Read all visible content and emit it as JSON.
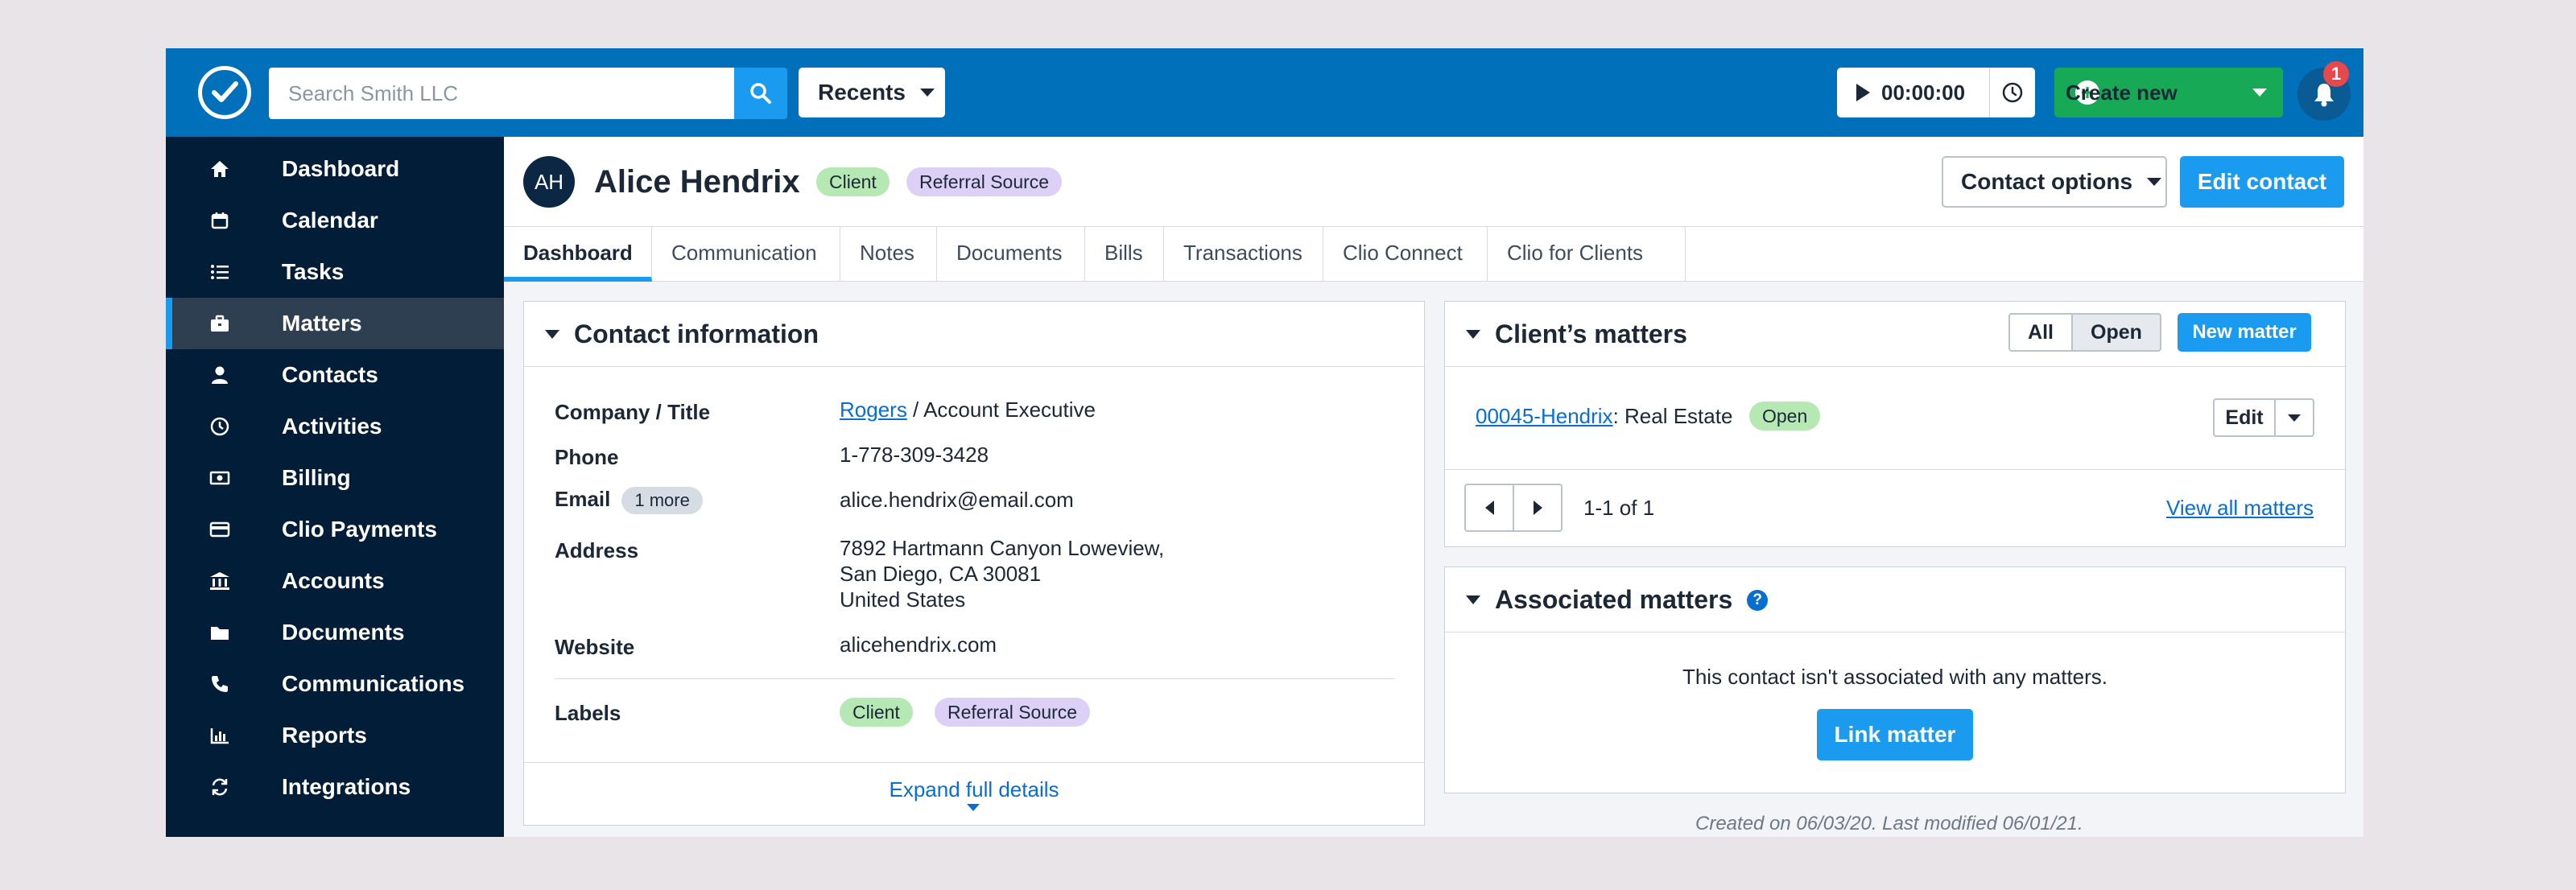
{
  "topbar": {
    "search_placeholder": "Search Smith LLC",
    "recents_label": "Recents",
    "timer": "00:00:00",
    "create_label": "Create new",
    "notification_count": "1"
  },
  "sidebar": {
    "items": [
      {
        "label": "Dashboard",
        "icon": "home-icon"
      },
      {
        "label": "Calendar",
        "icon": "calendar-icon"
      },
      {
        "label": "Tasks",
        "icon": "list-icon"
      },
      {
        "label": "Matters",
        "icon": "briefcase-icon",
        "active": true
      },
      {
        "label": "Contacts",
        "icon": "person-icon"
      },
      {
        "label": "Activities",
        "icon": "clock-icon"
      },
      {
        "label": "Billing",
        "icon": "money-icon"
      },
      {
        "label": "Clio Payments",
        "icon": "card-icon"
      },
      {
        "label": "Accounts",
        "icon": "bank-icon"
      },
      {
        "label": "Documents",
        "icon": "folder-icon"
      },
      {
        "label": "Communications",
        "icon": "phone-icon"
      },
      {
        "label": "Reports",
        "icon": "chart-icon"
      },
      {
        "label": "Integrations",
        "icon": "sync-icon"
      }
    ]
  },
  "contact": {
    "initials": "AH",
    "name": "Alice Hendrix",
    "labels": [
      "Client",
      "Referral Source"
    ],
    "options_label": "Contact options",
    "edit_label": "Edit contact"
  },
  "tabs": [
    "Dashboard",
    "Communication",
    "Notes",
    "Documents",
    "Bills",
    "Transactions",
    "Clio Connect",
    "Clio for Clients"
  ],
  "contact_info": {
    "title": "Contact information",
    "company_label": "Company / Title",
    "company": "Rogers",
    "company_sep": " / Account Executive",
    "phone_label": "Phone",
    "phone": "1-778-309-3428",
    "email_label": "Email",
    "email_more": "1 more",
    "email": "alice.hendrix@email.com",
    "address_label": "Address",
    "address_lines": [
      "7892 Hartmann Canyon Loweview,",
      "San Diego, CA 30081",
      "United States"
    ],
    "website_label": "Website",
    "website": "alicehendrix.com",
    "labels_label": "Labels",
    "labels": [
      "Client",
      "Referral Source"
    ],
    "expand_label": "Expand full details"
  },
  "clients_matters": {
    "title": "Client’s matters",
    "filter_all": "All",
    "filter_open": "Open",
    "new_matter_label": "New matter",
    "matter_link": "00045-Hendrix",
    "matter_desc": ": Real Estate",
    "matter_status": "Open",
    "edit_label": "Edit",
    "pagination": "1-1 of 1",
    "view_all": "View all matters"
  },
  "associated_matters": {
    "title": "Associated matters",
    "empty_text": "This contact isn't associated with any matters.",
    "link_label": "Link matter"
  },
  "footer_note": "Created on 06/03/20. Last modified 06/01/21.",
  "colors": {
    "brand_blue": "#0070bb",
    "sidebar_bg": "#021d38",
    "primary_button": "#1a9bf0",
    "create_green": "#18a957",
    "client_pill": "#b5e8b3",
    "referral_pill": "#ddd0f7"
  }
}
